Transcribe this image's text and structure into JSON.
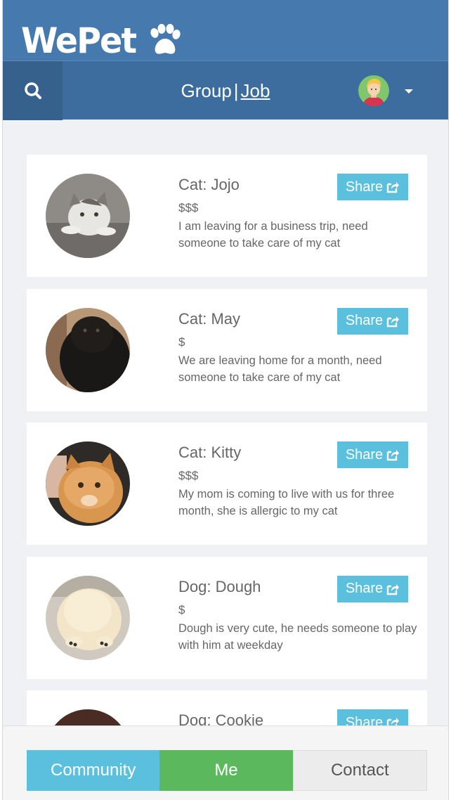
{
  "app": {
    "brand": "WePet",
    "accent_color": "#4679ad"
  },
  "nav": {
    "group_label": "Group",
    "separator": "|",
    "job_label": "Job"
  },
  "posts": [
    {
      "name": "Cat: Jojo",
      "price": "$$$",
      "description": "I am leaving for a business trip, need someone to take care of my cat",
      "share_label": "Share"
    },
    {
      "name": "Cat: May",
      "price": "$",
      "description": "We are leaving home for a month, need someone to take care of my cat",
      "share_label": "Share"
    },
    {
      "name": "Cat: Kitty",
      "price": "$$$",
      "description": "My mom is coming to live with us for three month, she is allergic to my cat",
      "share_label": "Share"
    },
    {
      "name": "Dog: Dough",
      "price": "$",
      "description": "Dough is very cute, he needs someone to play with him at weekday",
      "share_label": "Share"
    },
    {
      "name": "Dog: Cookie",
      "price": "",
      "description": "",
      "share_label": "Share"
    }
  ],
  "footer": {
    "tabs": [
      {
        "label": "Community",
        "color": "#5bc0de"
      },
      {
        "label": "Me",
        "color": "#5cb85c"
      },
      {
        "label": "Contact",
        "color": "#ececec"
      }
    ]
  }
}
